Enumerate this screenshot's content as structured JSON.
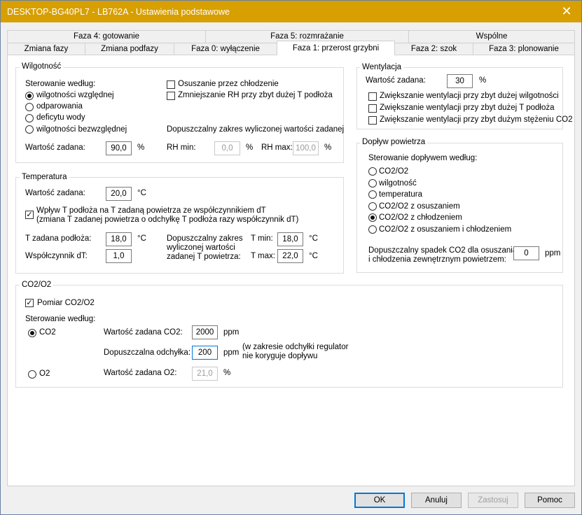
{
  "window": {
    "title": "DESKTOP-BG40PL7 - LB762A - Ustawienia podstawowe",
    "close_glyph": "✕"
  },
  "tabs_row1": [
    "Faza 4: gotowanie",
    "Faza 5: rozmrażanie",
    "Wspólne"
  ],
  "tabs_row2": [
    "Zmiana fazy",
    "Zmiana podfazy",
    "Faza 0: wyłączenie",
    "Faza 1: przerost grzybni",
    "Faza 2: szok",
    "Faza 3: plonowanie"
  ],
  "wilgotnosc": {
    "title": "Wilgotność",
    "control_label": "Sterowanie według:",
    "options": [
      "wilgotności względnej",
      "odparowania",
      "deficytu wody",
      "wilgotności bezwzględnej"
    ],
    "dry_cooling": "Osuszanie przez chłodzenie",
    "reduce_rh": "Zmniejszanie RH przy zbyt dużej T podłoża",
    "range_title": "Dopuszczalny zakres wyliczonej wartości zadanej",
    "setpoint_label": "Wartość zadana:",
    "setpoint_value": "90,0",
    "setpoint_unit": "%",
    "rhmin_label": "RH min:",
    "rhmin_value": "0,0",
    "rhmin_unit": "%",
    "rhmax_label": "RH max:",
    "rhmax_value": "100,0",
    "rhmax_unit": "%"
  },
  "temperatura": {
    "title": "Temperatura",
    "setpoint_label": "Wartość zadana:",
    "setpoint_value": "20,0",
    "unit_c": "°C",
    "influence_line1": "Wpływ T podłoża na T zadaną powietrza ze współczynnikiem dT",
    "influence_line2": "(zmiana T zadanej powietrza o odchyłkę T podłoża razy współczynnik dT)",
    "substrate_label": "T zadana podłoża:",
    "substrate_value": "18,0",
    "coef_label": "Współczynnik dT:",
    "coef_value": "1,0",
    "range_line1": "Dopuszczalny zakres",
    "range_line2": "wyliczonej wartości",
    "range_line3": "zadanej T powietrza:",
    "tmin_label": "T min:",
    "tmin_value": "18,0",
    "tmax_label": "T max:",
    "tmax_value": "22,0"
  },
  "wentylacja": {
    "title": "Wentylacja",
    "setpoint_label": "Wartość zadana:",
    "setpoint_value": "30",
    "unit": "%",
    "checks": [
      "Zwiększanie wentylacji przy zbyt dużej wilgotności",
      "Zwiększanie wentylacji przy zbyt dużej T podłoża",
      "Zwiększanie wentylacji przy zbyt dużym stężeniu CO2"
    ]
  },
  "doplyw": {
    "title": "Dopływ powietrza",
    "control_label": "Sterowanie dopływem według:",
    "options": [
      "CO2/O2",
      "wilgotność",
      "temperatura",
      "CO2/O2 z osuszaniem",
      "CO2/O2 z chłodzeniem",
      "CO2/O2 z osuszaniem i chłodzeniem"
    ],
    "drop_line1": "Dopuszczalny spadek CO2 dla osuszania",
    "drop_line2": "i chłodzenia zewnętrznym powietrzem:",
    "drop_value": "0",
    "drop_unit": "ppm"
  },
  "co2o2": {
    "title": "CO2/O2",
    "measure_label": "Pomiar CO2/O2",
    "control_label": "Sterowanie według:",
    "co2_label": "CO2",
    "o2_label": "O2",
    "co2_setpoint_label": "Wartość zadana CO2:",
    "co2_setpoint_value": "2000",
    "ppm": "ppm",
    "deviation_label": "Dopuszczalna odchyłka:",
    "deviation_value": "200",
    "deviation_note1": "(w zakresie odchyłki regulator",
    "deviation_note2": "nie koryguje dopływu",
    "o2_setpoint_label": "Wartość zadana O2:",
    "o2_setpoint_value": "21,0",
    "o2_unit": "%"
  },
  "buttons": {
    "ok": "OK",
    "cancel": "Anuluj",
    "apply": "Zastosuj",
    "help": "Pomoc"
  }
}
